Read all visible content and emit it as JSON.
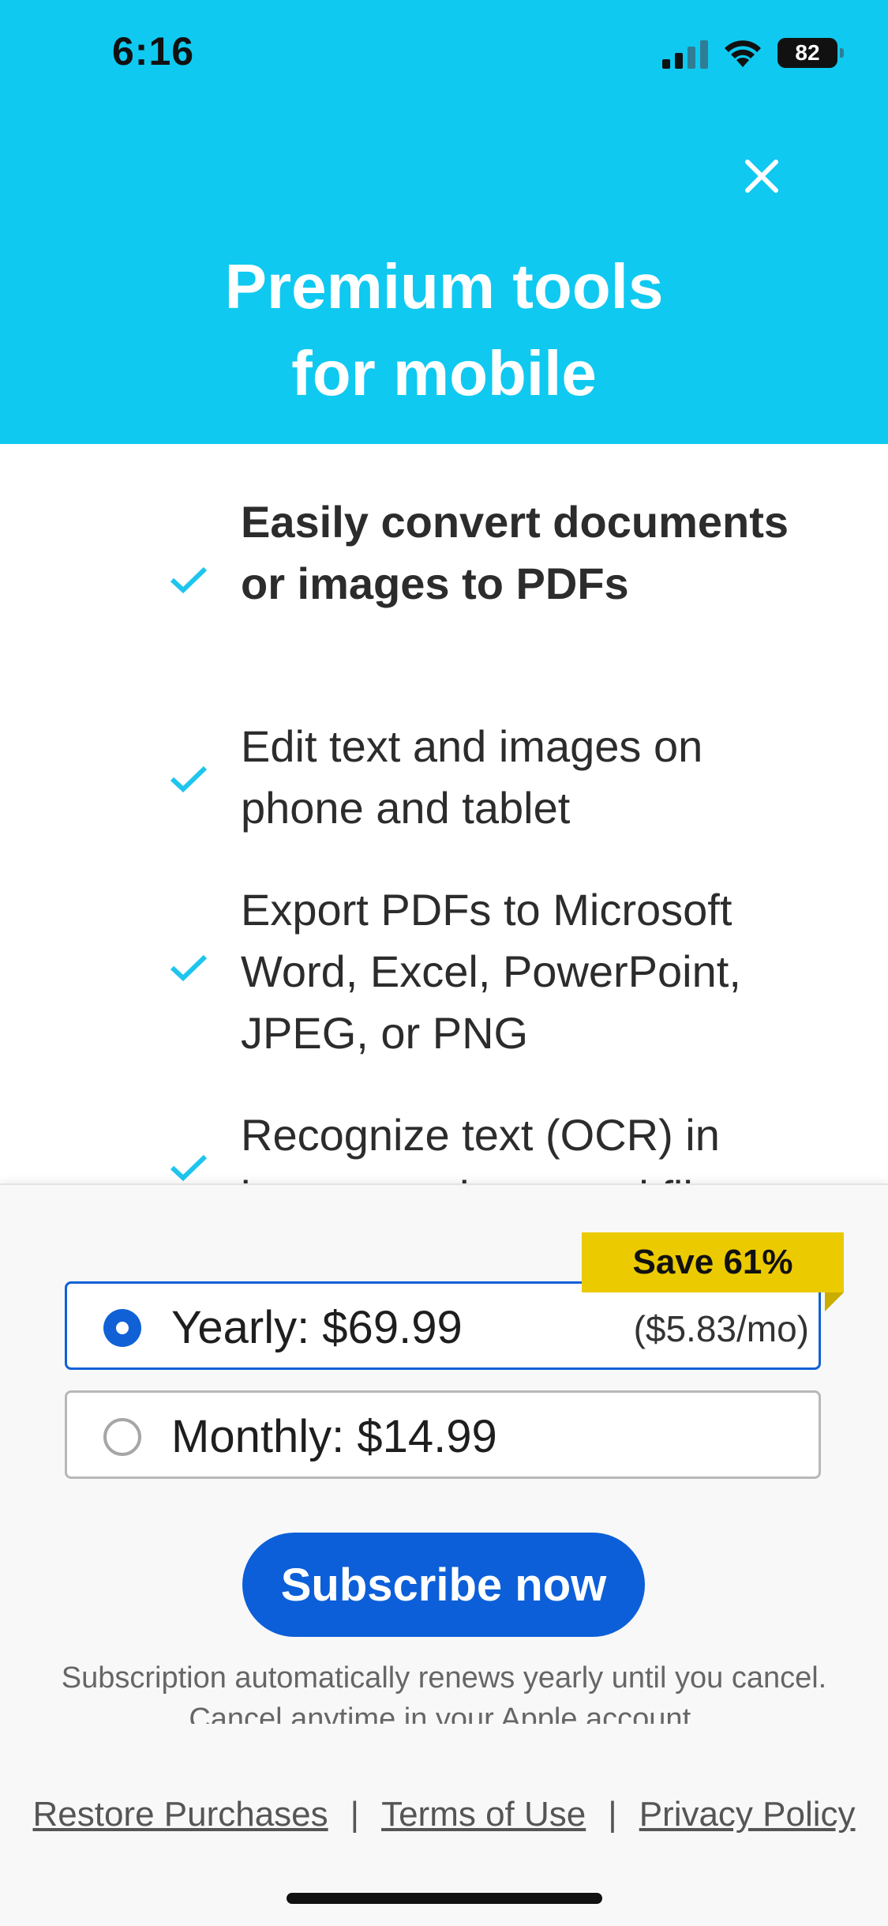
{
  "status_bar": {
    "time": "6:16",
    "battery": "82"
  },
  "header": {
    "title_line1": "Premium tools",
    "title_line2": "for mobile",
    "close_icon": "close-icon"
  },
  "features": [
    {
      "text": "Easily convert documents or images to PDFs",
      "bold": true
    },
    {
      "text": "Edit text and images on phone and tablet",
      "bold": false
    },
    {
      "text": "Export PDFs to Microsoft Word, Excel, PowerPoint, JPEG, or PNG",
      "bold": false
    },
    {
      "text": "Recognize text (OCR) in images and scanned files",
      "bold": false
    }
  ],
  "plans": {
    "save_badge": "Save 61%",
    "yearly": {
      "label": "Yearly: $69.99",
      "sub": "($5.83/mo)",
      "selected": true
    },
    "monthly": {
      "label": "Monthly: $14.99",
      "selected": false
    }
  },
  "subscribe_label": "Subscribe now",
  "renewal_text": "Subscription automatically renews yearly until you cancel. Cancel anytime in your Apple account.",
  "footer": {
    "restore": "Restore Purchases",
    "terms": "Terms of Use",
    "privacy": "Privacy Policy",
    "separator": "|"
  },
  "colors": {
    "header_bg": "#0fc9f0",
    "accent_blue": "#1161d6",
    "check_color": "#1ec5ee",
    "badge_yellow": "#ebca00"
  }
}
